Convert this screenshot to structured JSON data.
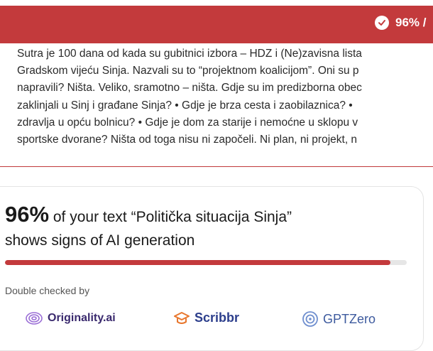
{
  "banner": {
    "badge_text": "96% /",
    "color": "#c33a3c"
  },
  "article": {
    "lines": [
      "Sutra je 100 dana od kada su gubitnici izbora – HDZ i (Ne)zavisna lista",
      "Gradskom vijeću Sinja. Nazvali su to “projektnom koalicijom”. Oni su p",
      "napravili? Ništa. Veliko, sramotno – ništa. Gdje su im predizborna obec",
      "zaklinjali u Sinj i građane Sinja? • Gdje je brza cesta i zaobilaznica? •",
      "zdravlja u opću bolnicu? • Gdje je dom za starije i nemoćne u sklopu v",
      "sportske dvorane? Ništa od toga nisu ni započeli. Ni plan, ni projekt, n"
    ]
  },
  "result": {
    "percent": "96%",
    "headline_rest_1": " of your text “Politička situacija Sinja”",
    "headline_line_2": "shows signs of AI generation",
    "progress_fraction": 0.96,
    "checked_by_label": "Double checked by",
    "checkers": [
      {
        "name": "Originality.ai",
        "icon": "originality-icon",
        "color": "#3a2a6e"
      },
      {
        "name": "Scribbr",
        "icon": "scribbr-icon",
        "color": "#2c3e8c"
      },
      {
        "name": "GPTZero",
        "icon": "gptzero-icon",
        "color": "#3d5a9e"
      }
    ]
  }
}
